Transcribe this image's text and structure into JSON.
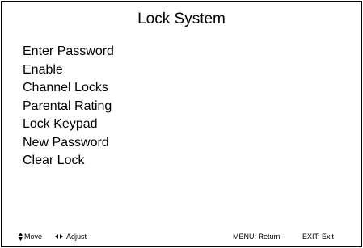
{
  "screen": {
    "title": "Lock System"
  },
  "menu": {
    "items": [
      {
        "label": "Enter Password"
      },
      {
        "label": "Enable"
      },
      {
        "label": "Channel Locks"
      },
      {
        "label": "Parental Rating"
      },
      {
        "label": "Lock Keypad"
      },
      {
        "label": "New Password"
      },
      {
        "label": "Clear Lock"
      }
    ]
  },
  "footer": {
    "move_icon": "up-down-arrow-icon",
    "move_label": "Move",
    "adjust_icon": "left-right-arrow-icon",
    "adjust_label": "Adjust",
    "return_label": "MENU: Return",
    "exit_label": "EXIT: Exit"
  }
}
